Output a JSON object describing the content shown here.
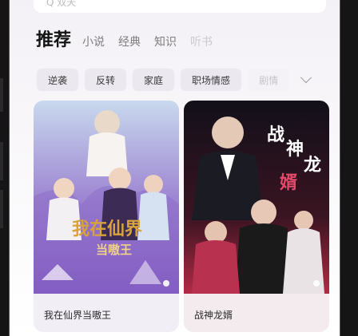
{
  "search": {
    "placeholder": "Q 双天"
  },
  "tabs": {
    "active": "推荐",
    "items": [
      "小说",
      "经典",
      "知识",
      "听书"
    ]
  },
  "chips": [
    "逆袭",
    "反转",
    "家庭",
    "职场情感",
    "剧情"
  ],
  "cards": [
    {
      "title": "我在仙界当嗷王",
      "poster_text": [
        "我在仙界",
        "当嗷王"
      ],
      "poster_colors": {
        "top": "#c8d9ee",
        "bottom": "#7b4fbf",
        "accent": "#d8a33a"
      }
    },
    {
      "title": "战神龙婿",
      "poster_text": [
        "战",
        "神",
        "龙",
        "婿"
      ],
      "poster_colors": {
        "top": "#11101a",
        "bottom": "#b22a45",
        "accent": "#e44a6a"
      }
    }
  ]
}
